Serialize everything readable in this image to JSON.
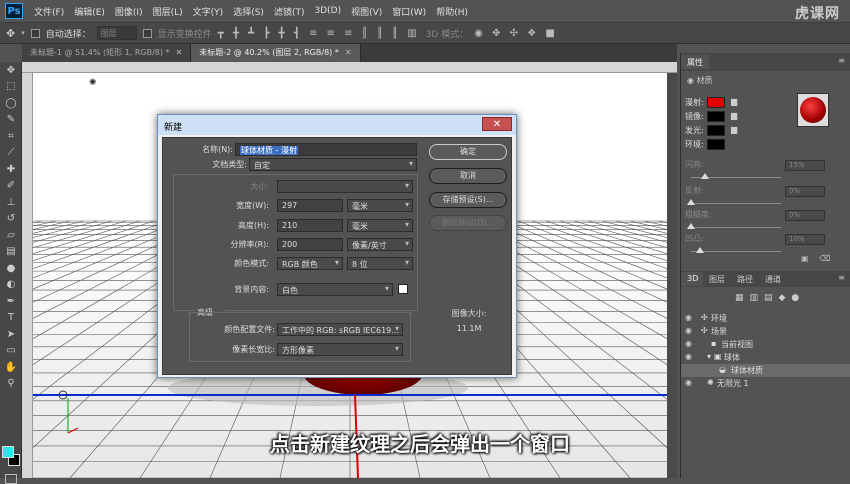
{
  "menu": [
    "文件(F)",
    "编辑(E)",
    "图像(I)",
    "图层(L)",
    "文字(Y)",
    "选择(S)",
    "滤镜(T)",
    "3D(D)",
    "视图(V)",
    "窗口(W)",
    "帮助(H)"
  ],
  "app_logo": "Ps",
  "watermark": "虎课网",
  "options": {
    "auto_select": "自动选择：",
    "group": "图层",
    "show_transform": "显示变换控件",
    "mode_3d": "3D 模式："
  },
  "tabs": [
    {
      "label": "未标题-1 @ 51.4% (矩形 1, RGB/8) *",
      "active": false
    },
    {
      "label": "未标题-2 @ 40.2% (图层 2, RGB/8) *",
      "active": true
    }
  ],
  "tools": [
    "move-icon",
    "marquee-icon",
    "lasso-icon",
    "quick-select-icon",
    "crop-icon",
    "eyedropper-icon",
    "healing-icon",
    "brush-icon",
    "clone-icon",
    "history-brush-icon",
    "eraser-icon",
    "gradient-icon",
    "blur-icon",
    "dodge-icon",
    "pen-icon",
    "type-icon",
    "path-select-icon",
    "shape-icon",
    "hand-icon",
    "zoom-icon"
  ],
  "colors": {
    "foreground": "#2ce6ec",
    "background": "#000000",
    "sphere": "#c00000",
    "grid_blue": "#0a2bd0",
    "grid_red": "#e00000"
  },
  "dialog": {
    "title": "新建",
    "close": "✕",
    "name_label": "名称(N):",
    "name_value": "球体材质 - 漫射",
    "doc_type_label": "文档类型:",
    "doc_type_value": "自定",
    "size_label": "大小:",
    "width_label": "宽度(W):",
    "width_value": "297",
    "width_unit": "毫米",
    "height_label": "高度(H):",
    "height_value": "210",
    "height_unit": "毫米",
    "resolution_label": "分辨率(R):",
    "resolution_value": "200",
    "resolution_unit": "像素/英寸",
    "color_mode_label": "颜色模式:",
    "color_mode_value": "RGB 颜色",
    "bit_depth": "8 位",
    "bg_label": "背景内容:",
    "bg_value": "白色",
    "advanced": "高级",
    "profile_label": "颜色配置文件:",
    "profile_value": "工作中的 RGB: sRGB IEC619...",
    "pixel_ratio_label": "像素长宽比:",
    "pixel_ratio_value": "方形像素",
    "ok": "确定",
    "cancel": "取消",
    "save_preset": "存储预设(S)...",
    "delete_preset": "删除预设(D)...",
    "image_size_label": "图像大小:",
    "image_size_value": "11.1M"
  },
  "properties": {
    "title": "属性",
    "section": "材质",
    "rows": [
      {
        "label": "漫射:",
        "color": "#e00000"
      },
      {
        "label": "镜像:",
        "color": "#000000"
      },
      {
        "label": "发光:",
        "color": "#000000"
      },
      {
        "label": "环境:",
        "color": "#000000"
      }
    ],
    "sliders": [
      {
        "label": "闪亮:",
        "value": "15%",
        "level": 0.15
      },
      {
        "label": "反射:",
        "value": "0%",
        "level": 0
      },
      {
        "label": "粗糙度:",
        "value": "0%",
        "level": 0
      },
      {
        "label": "凹凸:",
        "value": "10%",
        "level": 0.1
      }
    ]
  },
  "layers_tabs": [
    "3D",
    "图层",
    "路径",
    "通道"
  ],
  "layers": [
    {
      "label": "环境",
      "indent": 0,
      "selected": false
    },
    {
      "label": "场景",
      "indent": 0,
      "selected": false
    },
    {
      "label": "当前视图",
      "indent": 1,
      "selected": false
    },
    {
      "label": "球体",
      "indent": 1,
      "selected": false
    },
    {
      "label": "球体材质",
      "indent": 2,
      "selected": true
    },
    {
      "label": "无限光 1",
      "indent": 1,
      "selected": false
    }
  ],
  "subtitle": "点击新建纹理之后会弹出一个窗口"
}
